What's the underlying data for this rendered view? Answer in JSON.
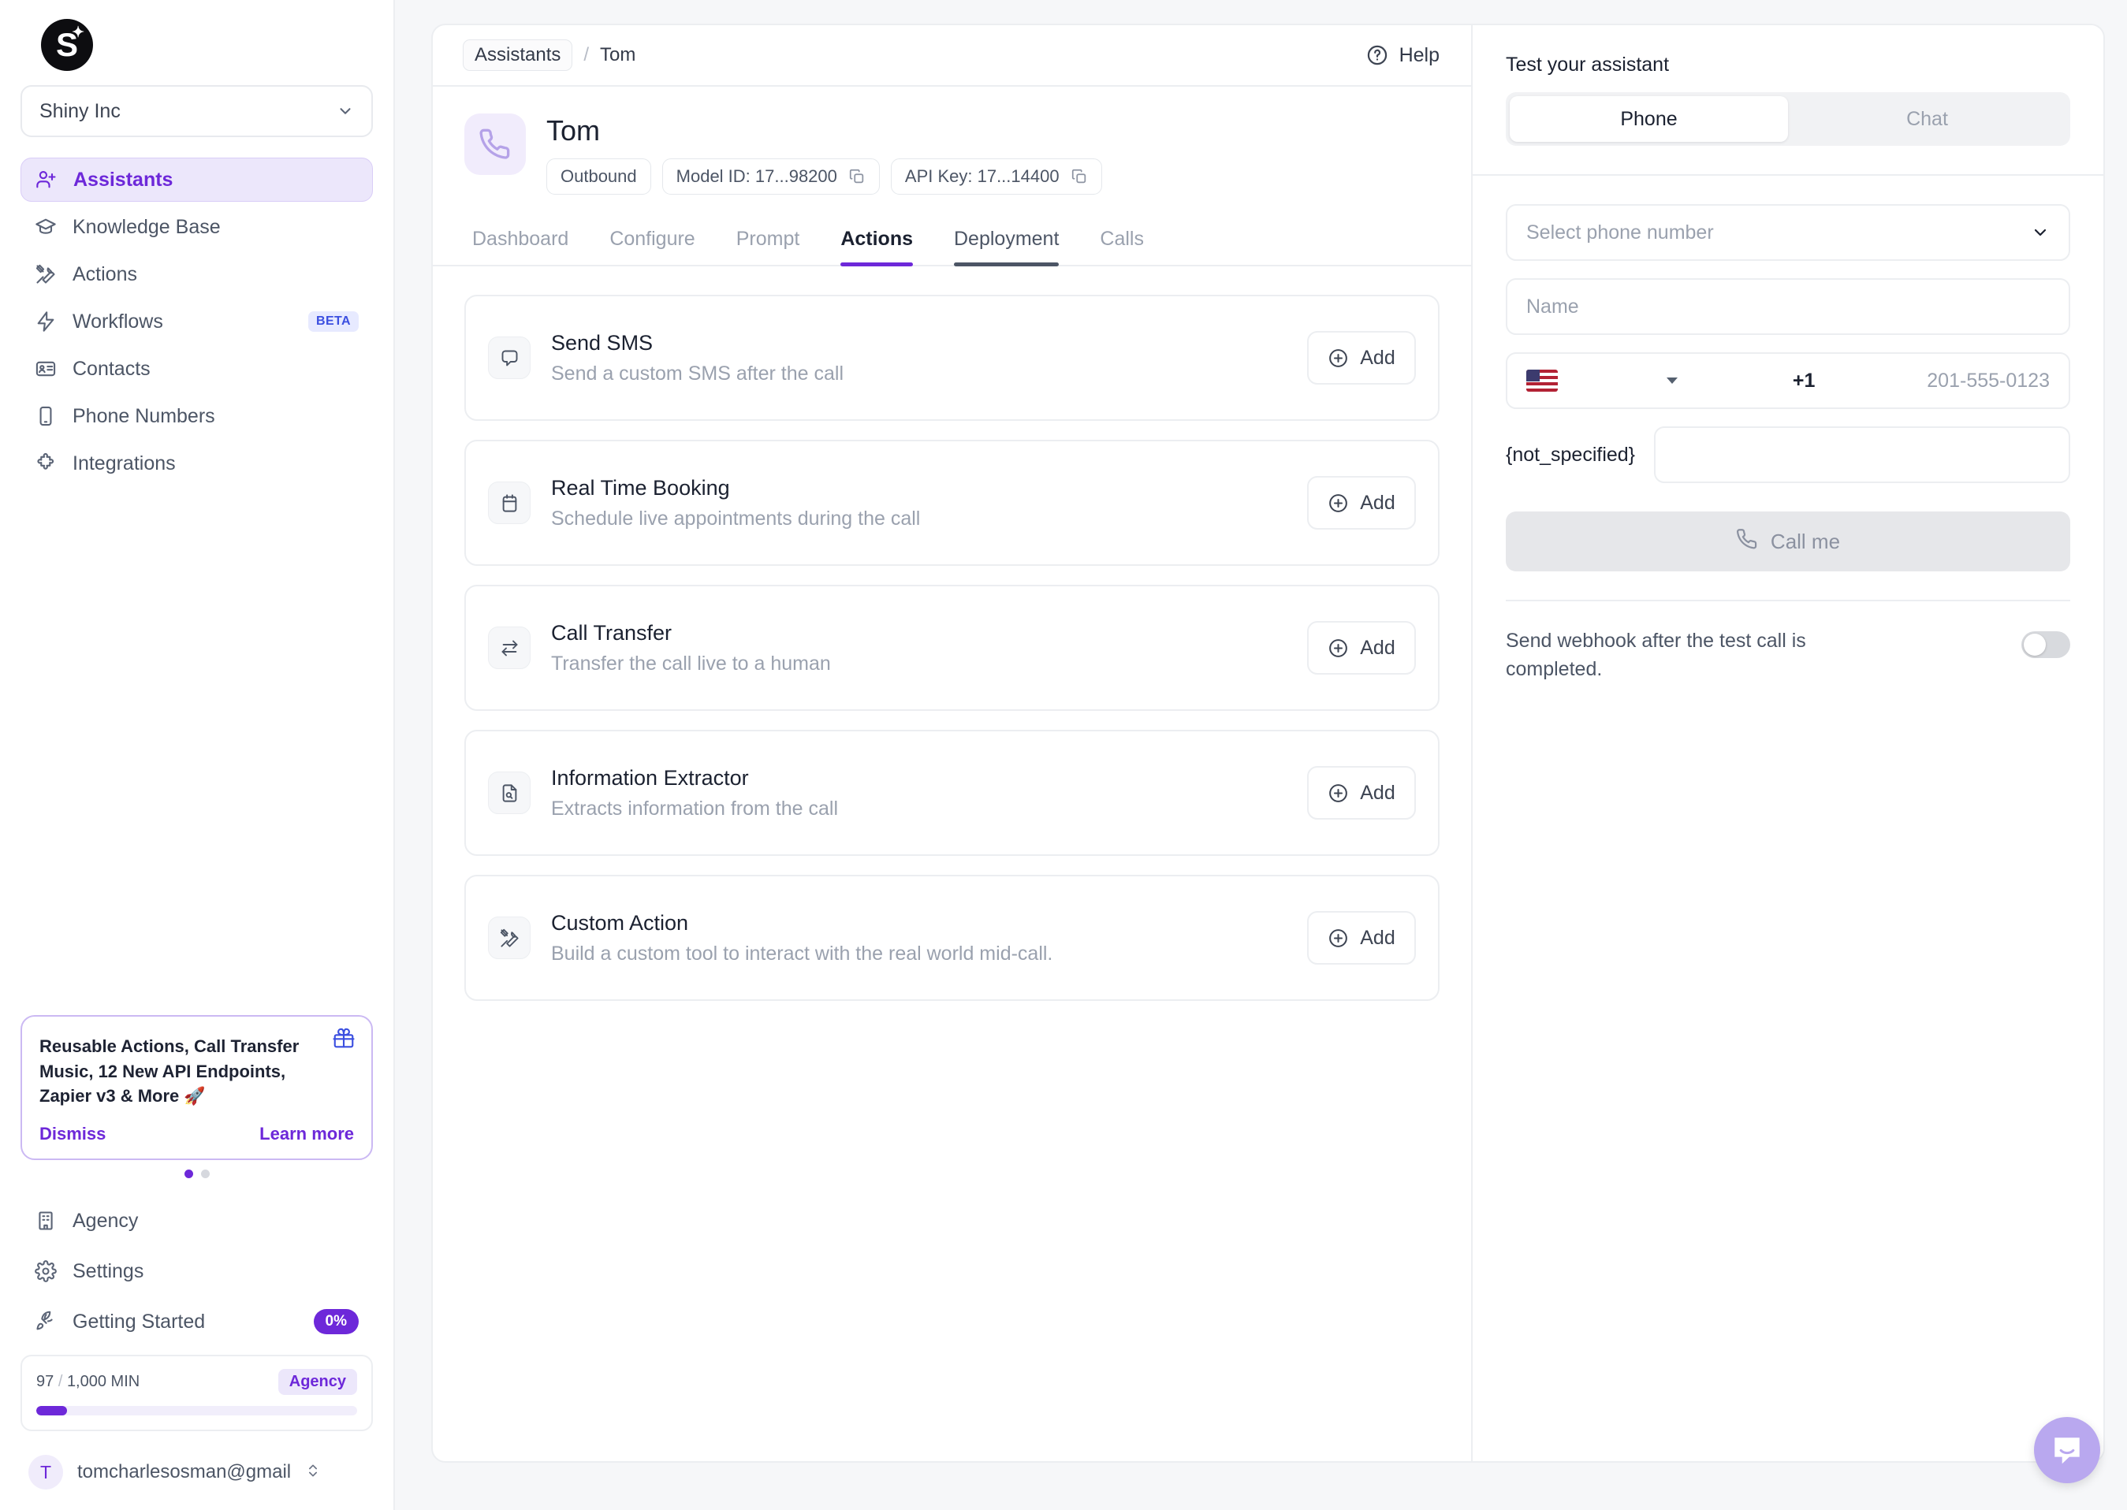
{
  "brand": {
    "logo_letter": "S",
    "accent": "#6d28d9",
    "beta_badge_color": "#3b4fe0"
  },
  "sidebar": {
    "org_name": "Shiny Inc",
    "nav": [
      {
        "label": "Assistants",
        "icon": "user-plus-icon",
        "active": true
      },
      {
        "label": "Knowledge Base",
        "icon": "graduation-cap-icon",
        "active": false
      },
      {
        "label": "Actions",
        "icon": "tools-icon",
        "active": false
      },
      {
        "label": "Workflows",
        "icon": "lightning-icon",
        "active": false,
        "badge": "BETA"
      },
      {
        "label": "Contacts",
        "icon": "contact-card-icon",
        "active": false
      },
      {
        "label": "Phone Numbers",
        "icon": "mobile-phone-icon",
        "active": false
      },
      {
        "label": "Integrations",
        "icon": "puzzle-piece-icon",
        "active": false
      }
    ],
    "promo": {
      "text": "Reusable Actions, Call Transfer Music, 12 New API Endpoints, Zapier v3 & More 🚀",
      "dismiss_label": "Dismiss",
      "learn_more_label": "Learn more"
    },
    "bottom_nav": [
      {
        "label": "Agency",
        "icon": "building-icon"
      },
      {
        "label": "Settings",
        "icon": "gear-icon"
      },
      {
        "label": "Getting Started",
        "icon": "rocket-icon",
        "badge": "0%"
      }
    ],
    "usage": {
      "used": "97",
      "separator": "/",
      "total": "1,000 MIN",
      "plan_badge": "Agency",
      "percent_filled": 9.7
    },
    "account": {
      "initial": "T",
      "email": "tomcharlesosman@gmail"
    }
  },
  "header": {
    "breadcrumb_parent": "Assistants",
    "breadcrumb_separator": "/",
    "breadcrumb_current": "Tom",
    "help_label": "Help"
  },
  "assistant": {
    "name": "Tom",
    "avatar_icon": "phone-icon",
    "chips": [
      {
        "label": "Outbound",
        "copyable": false
      },
      {
        "label": "Model ID: 17...98200",
        "copyable": true
      },
      {
        "label": "API Key: 17...14400",
        "copyable": true
      }
    ]
  },
  "tabs": [
    {
      "label": "Dashboard",
      "state": "idle"
    },
    {
      "label": "Configure",
      "state": "idle"
    },
    {
      "label": "Prompt",
      "state": "idle"
    },
    {
      "label": "Actions",
      "state": "active"
    },
    {
      "label": "Deployment",
      "state": "hovered"
    },
    {
      "label": "Calls",
      "state": "idle"
    }
  ],
  "actions": [
    {
      "title": "Send SMS",
      "desc": "Send a custom SMS after the call",
      "icon": "message-bubble-icon",
      "button": "Add"
    },
    {
      "title": "Real Time Booking",
      "desc": "Schedule live appointments during the call",
      "icon": "calendar-icon",
      "button": "Add"
    },
    {
      "title": "Call Transfer",
      "desc": "Transfer the call live to a human",
      "icon": "transfer-arrows-icon",
      "button": "Add"
    },
    {
      "title": "Information Extractor",
      "desc": "Extracts information from the call",
      "icon": "document-search-icon",
      "button": "Add"
    },
    {
      "title": "Custom Action",
      "desc": "Build a custom tool to interact with the real world mid-call.",
      "icon": "tools-icon",
      "button": "Add"
    }
  ],
  "test_panel": {
    "title": "Test your assistant",
    "segments": [
      {
        "label": "Phone",
        "selected": true
      },
      {
        "label": "Chat",
        "selected": false
      }
    ],
    "phone_select_placeholder": "Select phone number",
    "name_placeholder": "Name",
    "country_code": "+1",
    "country_flag": "us-flag-icon",
    "phone_placeholder": "201-555-0123",
    "variable_label": "{not_specified}",
    "variable_value": "",
    "call_button": "Call me",
    "webhook_label": "Send webhook after the test call is completed.",
    "webhook_enabled": false
  },
  "intercom": {
    "icon": "intercom-chat-icon"
  }
}
